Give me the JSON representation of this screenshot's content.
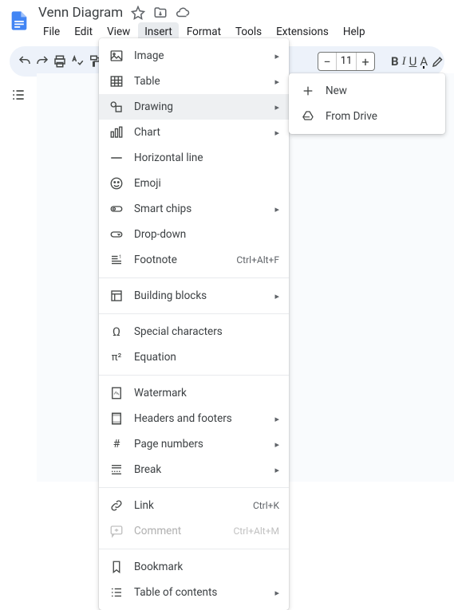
{
  "docTitle": "Venn Diagram",
  "menus": {
    "file": "File",
    "edit": "Edit",
    "view": "View",
    "insert": "Insert",
    "format": "Format",
    "tools": "Tools",
    "extensions": "Extensions",
    "help": "Help"
  },
  "toolbar": {
    "fontSize": "11",
    "bold": "B",
    "italic": "I",
    "underline": "U",
    "textColor": "A"
  },
  "insertMenu": {
    "image": "Image",
    "table": "Table",
    "drawing": "Drawing",
    "chart": "Chart",
    "hr": "Horizontal line",
    "emoji": "Emoji",
    "smartChips": "Smart chips",
    "dropdown": "Drop-down",
    "footnote": "Footnote",
    "footnoteShortcut": "Ctrl+Alt+F",
    "buildingBlocks": "Building blocks",
    "specialChars": "Special characters",
    "equation": "Equation",
    "watermark": "Watermark",
    "headersFooters": "Headers and footers",
    "pageNumbers": "Page numbers",
    "break": "Break",
    "link": "Link",
    "linkShortcut": "Ctrl+K",
    "comment": "Comment",
    "commentShortcut": "Ctrl+Alt+M",
    "bookmark": "Bookmark",
    "toc": "Table of contents"
  },
  "drawingSubmenu": {
    "new": "New",
    "fromDrive": "From Drive"
  }
}
